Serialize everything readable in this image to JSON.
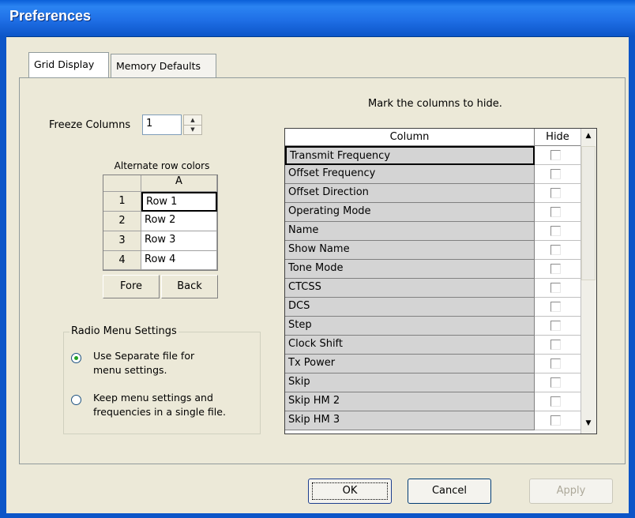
{
  "window": {
    "title": "Preferences"
  },
  "tabs": [
    {
      "label": "Grid Display",
      "selected": true
    },
    {
      "label": "Memory Defaults",
      "selected": false
    }
  ],
  "freeze": {
    "label": "Freeze Columns",
    "value": "1"
  },
  "alternate": {
    "caption": "Alternate row colors",
    "col_header": "A",
    "rows": [
      {
        "num": "1",
        "value": "Row 1"
      },
      {
        "num": "2",
        "value": "Row 2"
      },
      {
        "num": "3",
        "value": "Row 3"
      },
      {
        "num": "4",
        "value": "Row 4"
      }
    ],
    "fore_label": "Fore",
    "back_label": "Back"
  },
  "radio_menu": {
    "title": "Radio Menu Settings",
    "option1_line1": "Use Separate file for",
    "option1_line2": "menu settings.",
    "option2_line1": "Keep menu settings and",
    "option2_line2": "frequencies in a single file.",
    "selected": 1
  },
  "columns": {
    "instruction": "Mark the columns to hide.",
    "header_column": "Column",
    "header_hide": "Hide",
    "rows": [
      {
        "name": "Transmit Frequency",
        "hidden": false
      },
      {
        "name": "Offset Frequency",
        "hidden": false
      },
      {
        "name": "Offset Direction",
        "hidden": false
      },
      {
        "name": "Operating Mode",
        "hidden": false
      },
      {
        "name": "Name",
        "hidden": false
      },
      {
        "name": "Show Name",
        "hidden": false
      },
      {
        "name": "Tone Mode",
        "hidden": false
      },
      {
        "name": "CTCSS",
        "hidden": false
      },
      {
        "name": "DCS",
        "hidden": false
      },
      {
        "name": "Step",
        "hidden": false
      },
      {
        "name": "Clock Shift",
        "hidden": false
      },
      {
        "name": "Tx Power",
        "hidden": false
      },
      {
        "name": "Skip",
        "hidden": false
      },
      {
        "name": "Skip HM 2",
        "hidden": false
      },
      {
        "name": "Skip HM 3",
        "hidden": false
      }
    ]
  },
  "buttons": {
    "ok": "OK",
    "cancel": "Cancel",
    "apply": "Apply"
  },
  "colors": {
    "titlebar": "#1f6fe6",
    "dialog_bg": "#ece9d8",
    "accent": "#21a121"
  }
}
